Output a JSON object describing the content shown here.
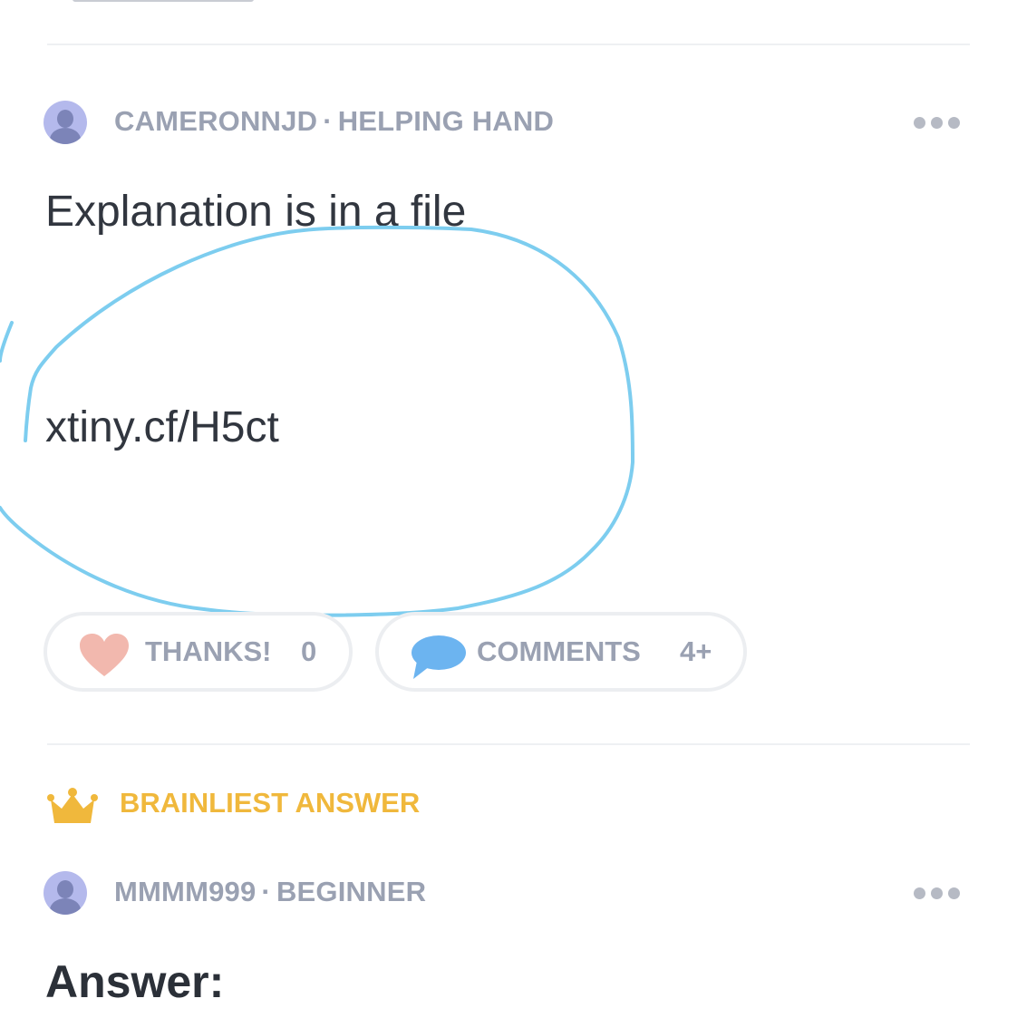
{
  "answer1": {
    "author": "CAMERONNJD",
    "separator": "·",
    "rank": "HELPING HAND",
    "line1": "Explanation is in a file",
    "line2": "xtiny.cf/H5ct",
    "thanks_label": "THANKS!",
    "thanks_count": "0",
    "comments_label": "COMMENTS",
    "comments_count": "4+"
  },
  "answer2": {
    "badge": "BRAINLIEST ANSWER",
    "author": "MMMM999",
    "separator": "·",
    "rank": "BEGINNER",
    "heading": "Answer:"
  },
  "colors": {
    "meta_text": "#9aa1b2",
    "body_text": "#31363f",
    "heart": "#f2b8ae",
    "comment_bubble": "#6cb4f0",
    "brainliest": "#f0b83c",
    "annotation": "#7dcdef",
    "divider": "#eef0f3"
  },
  "icons": [
    "avatar",
    "more-dots-icon",
    "heart-icon",
    "comment-bubble-icon",
    "crown-icon"
  ]
}
